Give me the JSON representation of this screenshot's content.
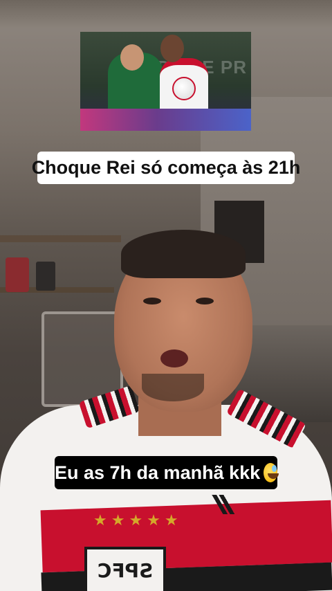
{
  "thumbnail": {
    "icon": "football-match-photo",
    "banner_colors": [
      "#c2387d",
      "#4b63c9"
    ]
  },
  "captions": {
    "top": "Choque Rei só começa às 21h",
    "bottom": "Eu as 7h da manhã kkk",
    "bottom_emoji": "grinning-face-with-sweat-emoji"
  },
  "colors": {
    "caption_top_bg": "#ffffff",
    "caption_bottom_bg": "#000000",
    "shirt_red": "#c8102e"
  }
}
